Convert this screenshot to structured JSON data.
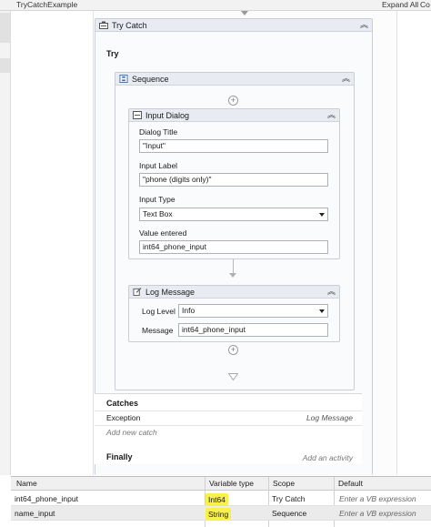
{
  "window": {
    "title": "TryCatchExample",
    "expand_all": "Expand All",
    "collapse_all": "Co"
  },
  "try_catch": {
    "label": "Try Catch",
    "try_label": "Try",
    "sequence": {
      "label": "Sequence",
      "input_dialog": {
        "label": "Input Dialog",
        "dialog_title_label": "Dialog Title",
        "dialog_title_value": "\"Input\"",
        "input_label_label": "Input Label",
        "input_label_value": "\"phone (digits only)\"",
        "input_type_label": "Input Type",
        "input_type_value": "Text Box",
        "value_entered_label": "Value entered",
        "value_entered_value": "int64_phone_input"
      },
      "log_message": {
        "label": "Log Message",
        "log_level_label": "Log Level",
        "log_level_value": "Info",
        "message_label": "Message",
        "message_value": "int64_phone_input"
      }
    },
    "catches_label": "Catches",
    "exception_label": "Exception",
    "exception_action": "Log Message",
    "add_new_catch": "Add new catch",
    "finally_label": "Finally",
    "finally_action": "Add an activity"
  },
  "variables": {
    "columns": [
      "Name",
      "Variable type",
      "Scope",
      "Default"
    ],
    "rows": [
      {
        "name": "int64_phone_input",
        "type": "Int64",
        "scope": "Try Catch",
        "default": "Enter a VB expression"
      },
      {
        "name": "name_input",
        "type": "String",
        "scope": "Sequence",
        "default": "Enter a VB expression"
      }
    ]
  },
  "colors": {
    "highlight": "#f9f04a",
    "header_bg": "#e8ecf2",
    "border": "#c9ced6"
  }
}
